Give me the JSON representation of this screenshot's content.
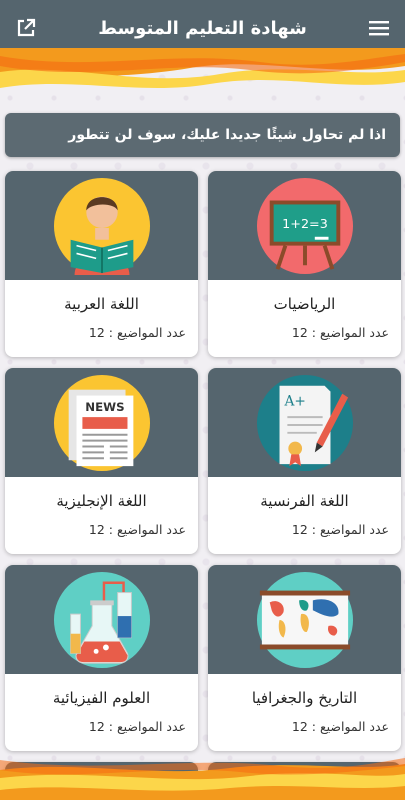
{
  "appbar": {
    "title": "شهادة التعليم المتوسط",
    "menu_icon": "hamburger-menu-icon",
    "share_icon": "external-link-icon"
  },
  "banner": {
    "text": "اذا لم تحاول شيئًا جديدا عليك، سوف لن تتطور"
  },
  "subjects": [
    {
      "name": "الرياضيات",
      "count": "عدد المواضيع : 12",
      "icon": "math-board-icon"
    },
    {
      "name": "اللغة العربية",
      "count": "عدد المواضيع : 12",
      "icon": "reading-student-icon"
    },
    {
      "name": "اللغة الفرنسية",
      "count": "عدد المواضيع : 12",
      "icon": "graded-paper-icon"
    },
    {
      "name": "اللغة الإنجليزية",
      "count": "عدد المواضيع : 12",
      "icon": "newspaper-icon"
    },
    {
      "name": "التاريخ والجغرافيا",
      "count": "عدد المواضيع : 12",
      "icon": "world-map-icon"
    },
    {
      "name": "العلوم الفيزيائية",
      "count": "عدد المواضيع : 12",
      "icon": "lab-flasks-icon"
    }
  ],
  "colors": {
    "appbar": "#55656e",
    "wave_orange": "#f39a1d",
    "wave_yellow": "#fcd64a"
  }
}
